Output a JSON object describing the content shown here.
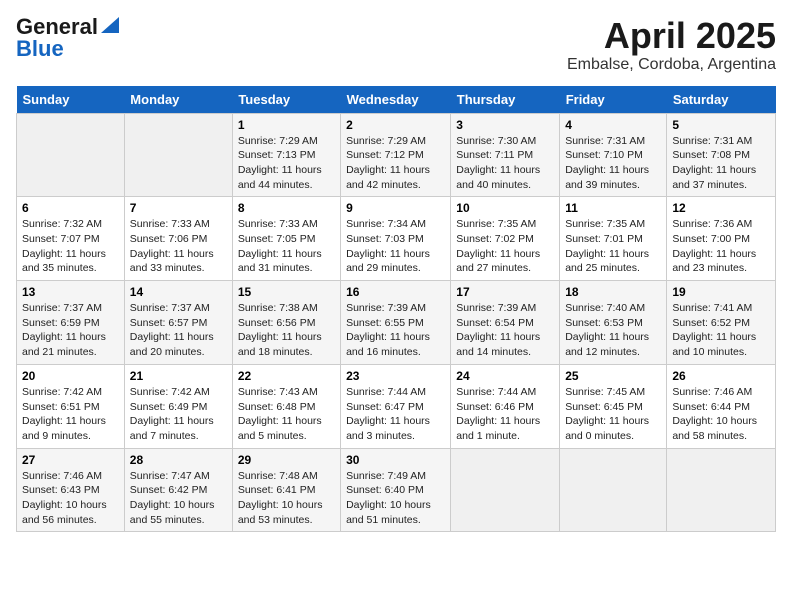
{
  "header": {
    "logo_general": "General",
    "logo_blue": "Blue",
    "title": "April 2025",
    "subtitle": "Embalse, Cordoba, Argentina"
  },
  "days_of_week": [
    "Sunday",
    "Monday",
    "Tuesday",
    "Wednesday",
    "Thursday",
    "Friday",
    "Saturday"
  ],
  "weeks": [
    [
      {
        "day": "",
        "empty": true
      },
      {
        "day": "",
        "empty": true
      },
      {
        "day": "1",
        "sunrise": "7:29 AM",
        "sunset": "7:13 PM",
        "daylight": "11 hours and 44 minutes."
      },
      {
        "day": "2",
        "sunrise": "7:29 AM",
        "sunset": "7:12 PM",
        "daylight": "11 hours and 42 minutes."
      },
      {
        "day": "3",
        "sunrise": "7:30 AM",
        "sunset": "7:11 PM",
        "daylight": "11 hours and 40 minutes."
      },
      {
        "day": "4",
        "sunrise": "7:31 AM",
        "sunset": "7:10 PM",
        "daylight": "11 hours and 39 minutes."
      },
      {
        "day": "5",
        "sunrise": "7:31 AM",
        "sunset": "7:08 PM",
        "daylight": "11 hours and 37 minutes."
      }
    ],
    [
      {
        "day": "6",
        "sunrise": "7:32 AM",
        "sunset": "7:07 PM",
        "daylight": "11 hours and 35 minutes."
      },
      {
        "day": "7",
        "sunrise": "7:33 AM",
        "sunset": "7:06 PM",
        "daylight": "11 hours and 33 minutes."
      },
      {
        "day": "8",
        "sunrise": "7:33 AM",
        "sunset": "7:05 PM",
        "daylight": "11 hours and 31 minutes."
      },
      {
        "day": "9",
        "sunrise": "7:34 AM",
        "sunset": "7:03 PM",
        "daylight": "11 hours and 29 minutes."
      },
      {
        "day": "10",
        "sunrise": "7:35 AM",
        "sunset": "7:02 PM",
        "daylight": "11 hours and 27 minutes."
      },
      {
        "day": "11",
        "sunrise": "7:35 AM",
        "sunset": "7:01 PM",
        "daylight": "11 hours and 25 minutes."
      },
      {
        "day": "12",
        "sunrise": "7:36 AM",
        "sunset": "7:00 PM",
        "daylight": "11 hours and 23 minutes."
      }
    ],
    [
      {
        "day": "13",
        "sunrise": "7:37 AM",
        "sunset": "6:59 PM",
        "daylight": "11 hours and 21 minutes."
      },
      {
        "day": "14",
        "sunrise": "7:37 AM",
        "sunset": "6:57 PM",
        "daylight": "11 hours and 20 minutes."
      },
      {
        "day": "15",
        "sunrise": "7:38 AM",
        "sunset": "6:56 PM",
        "daylight": "11 hours and 18 minutes."
      },
      {
        "day": "16",
        "sunrise": "7:39 AM",
        "sunset": "6:55 PM",
        "daylight": "11 hours and 16 minutes."
      },
      {
        "day": "17",
        "sunrise": "7:39 AM",
        "sunset": "6:54 PM",
        "daylight": "11 hours and 14 minutes."
      },
      {
        "day": "18",
        "sunrise": "7:40 AM",
        "sunset": "6:53 PM",
        "daylight": "11 hours and 12 minutes."
      },
      {
        "day": "19",
        "sunrise": "7:41 AM",
        "sunset": "6:52 PM",
        "daylight": "11 hours and 10 minutes."
      }
    ],
    [
      {
        "day": "20",
        "sunrise": "7:42 AM",
        "sunset": "6:51 PM",
        "daylight": "11 hours and 9 minutes."
      },
      {
        "day": "21",
        "sunrise": "7:42 AM",
        "sunset": "6:49 PM",
        "daylight": "11 hours and 7 minutes."
      },
      {
        "day": "22",
        "sunrise": "7:43 AM",
        "sunset": "6:48 PM",
        "daylight": "11 hours and 5 minutes."
      },
      {
        "day": "23",
        "sunrise": "7:44 AM",
        "sunset": "6:47 PM",
        "daylight": "11 hours and 3 minutes."
      },
      {
        "day": "24",
        "sunrise": "7:44 AM",
        "sunset": "6:46 PM",
        "daylight": "11 hours and 1 minute."
      },
      {
        "day": "25",
        "sunrise": "7:45 AM",
        "sunset": "6:45 PM",
        "daylight": "11 hours and 0 minutes."
      },
      {
        "day": "26",
        "sunrise": "7:46 AM",
        "sunset": "6:44 PM",
        "daylight": "10 hours and 58 minutes."
      }
    ],
    [
      {
        "day": "27",
        "sunrise": "7:46 AM",
        "sunset": "6:43 PM",
        "daylight": "10 hours and 56 minutes."
      },
      {
        "day": "28",
        "sunrise": "7:47 AM",
        "sunset": "6:42 PM",
        "daylight": "10 hours and 55 minutes."
      },
      {
        "day": "29",
        "sunrise": "7:48 AM",
        "sunset": "6:41 PM",
        "daylight": "10 hours and 53 minutes."
      },
      {
        "day": "30",
        "sunrise": "7:49 AM",
        "sunset": "6:40 PM",
        "daylight": "10 hours and 51 minutes."
      },
      {
        "day": "",
        "empty": true
      },
      {
        "day": "",
        "empty": true
      },
      {
        "day": "",
        "empty": true
      }
    ]
  ]
}
